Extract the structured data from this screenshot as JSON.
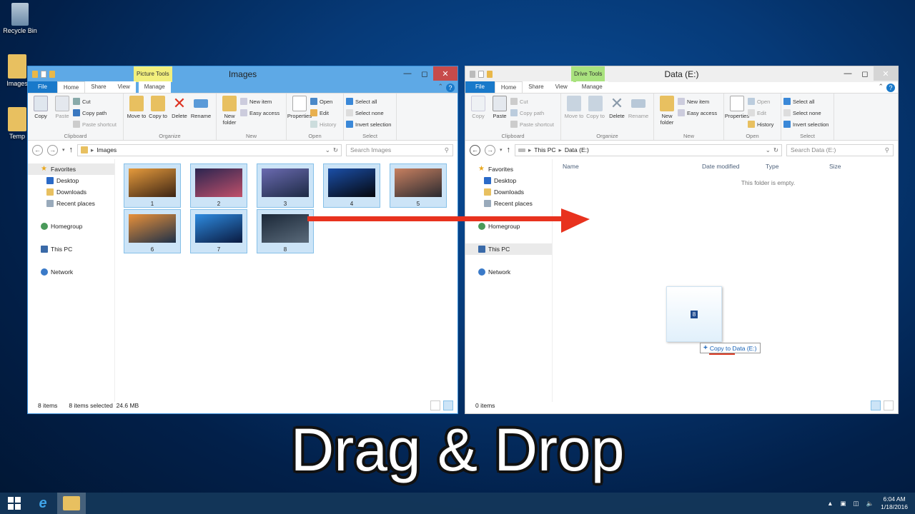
{
  "desktop": {
    "icons": [
      {
        "label": "Recycle Bin",
        "icon": "recycle-bin-icon"
      },
      {
        "label": "Images",
        "icon": "folder-icon"
      },
      {
        "label": "Temp",
        "icon": "folder-icon"
      }
    ]
  },
  "left_window": {
    "title": "Images",
    "context_tab": "Picture Tools",
    "tabs": [
      "File",
      "Home",
      "Share",
      "View",
      "Manage"
    ],
    "ribbon": {
      "clipboard": {
        "label": "Clipboard",
        "copy": "Copy",
        "paste": "Paste",
        "cut": "Cut",
        "copy_path": "Copy path",
        "paste_shortcut": "Paste shortcut"
      },
      "organize": {
        "label": "Organize",
        "move_to": "Move to",
        "copy_to": "Copy to",
        "delete": "Delete",
        "rename": "Rename"
      },
      "new": {
        "label": "New",
        "new_folder": "New folder",
        "new_item": "New item",
        "easy_access": "Easy access"
      },
      "open": {
        "label": "Open",
        "properties": "Properties",
        "open": "Open",
        "edit": "Edit",
        "history": "History"
      },
      "select": {
        "label": "Select",
        "select_all": "Select all",
        "select_none": "Select none",
        "invert": "Invert selection"
      }
    },
    "address": {
      "path": [
        "Images"
      ]
    },
    "search_placeholder": "Search Images",
    "nav": [
      "Favorites",
      "Desktop",
      "Downloads",
      "Recent places",
      "Homegroup",
      "This PC",
      "Network"
    ],
    "files": [
      {
        "name": "1",
        "c1": "#e59a3c",
        "c2": "#3c2414"
      },
      {
        "name": "2",
        "c1": "#2b2550",
        "c2": "#c0506a"
      },
      {
        "name": "3",
        "c1": "#6a6ab0",
        "c2": "#1d2a44"
      },
      {
        "name": "4",
        "c1": "#1b4fa8",
        "c2": "#05070d"
      },
      {
        "name": "5",
        "c1": "#c88060",
        "c2": "#2a2a30"
      },
      {
        "name": "6",
        "c1": "#e8903a",
        "c2": "#1e3048"
      },
      {
        "name": "7",
        "c1": "#2e8be0",
        "c2": "#0a1a40"
      },
      {
        "name": "8",
        "c1": "#1b2838",
        "c2": "#5a6a7a"
      }
    ],
    "status": {
      "count": "8 items",
      "selected": "8 items selected",
      "size": "24.6 MB"
    }
  },
  "right_window": {
    "title": "Data (E:)",
    "context_tab": "Drive Tools",
    "tabs": [
      "File",
      "Home",
      "Share",
      "View",
      "Manage"
    ],
    "address": {
      "path": [
        "This PC",
        "Data (E:)"
      ]
    },
    "search_placeholder": "Search Data (E:)",
    "nav": [
      "Favorites",
      "Desktop",
      "Downloads",
      "Recent places",
      "Homegroup",
      "This PC",
      "Network"
    ],
    "columns": [
      "Name",
      "Date modified",
      "Type",
      "Size"
    ],
    "empty_text": "This folder is empty.",
    "status": {
      "count": "0 items"
    }
  },
  "drag": {
    "badge": "8",
    "tooltip": "Copy to Data (E:)"
  },
  "caption": "Drag & Drop",
  "taskbar": {
    "time": "6:04 AM",
    "date": "1/18/2016"
  },
  "colors": {
    "arrow": "#e8321e",
    "accent": "#1979ca"
  }
}
